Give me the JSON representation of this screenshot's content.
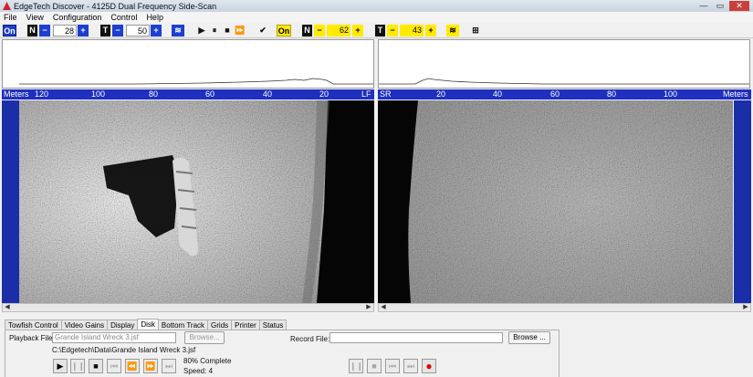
{
  "window": {
    "title": "EdgeTech  Discover - 4125D  Dual Frequency Side-Scan",
    "controls": [
      "—",
      "▭",
      "✕"
    ]
  },
  "menu": [
    "File",
    "View",
    "Configuration",
    "Control",
    "Help"
  ],
  "toolbar": {
    "left": {
      "on_label": "On",
      "n_label": "N",
      "minus": "−",
      "n_value": "28",
      "plus": "+",
      "t_label": "T",
      "t_value": "50"
    },
    "playback": {
      "play": "▶",
      "pause": "⏸",
      "stop": "■",
      "ffwd": "⏩",
      "check": "✔"
    },
    "right": {
      "on_label": "On",
      "n_label": "N",
      "minus": "−",
      "n_value": "62",
      "plus": "+",
      "t_label": "T",
      "t_value": "43"
    }
  },
  "scales": {
    "left": {
      "unit": "Meters",
      "ticks": [
        "120",
        "100",
        "80",
        "60",
        "40",
        "20",
        "LF"
      ]
    },
    "right": {
      "unit": "Meters",
      "ticks": [
        "SR",
        "20",
        "40",
        "60",
        "80",
        "100"
      ]
    }
  },
  "tabs": [
    "Towfish Control",
    "Video Gains",
    "Display",
    "Disk",
    "Bottom Track",
    "Grids",
    "Printer",
    "Status"
  ],
  "active_tab": "Disk",
  "disk": {
    "playback_label": "Playback File:",
    "playback_value": "Grande Island Wreck 3.jsf",
    "browse_label": "Browse...",
    "path": "C:\\Edgetech\\Data\\Grande Island Wreck 3.jsf",
    "progress_text": "80% Complete",
    "speed_text": "Speed: 4",
    "record_label": "Record File:",
    "record_value": "",
    "record_browse": "Browse ..."
  },
  "colors": {
    "scale_bar": "#1f2fbf",
    "blue_accent": "#1c3fd0",
    "yellow_accent": "#ffea00",
    "record": "#e00000"
  }
}
